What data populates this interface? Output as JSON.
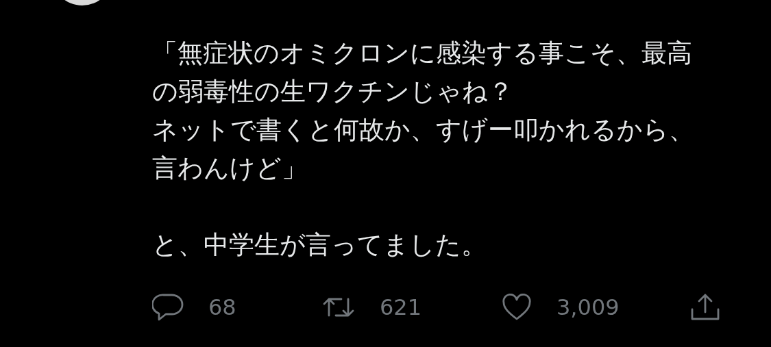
{
  "tweet": {
    "paragraphs": [
      {
        "lines": [
          "「無症状のオミクロンに感染する事こそ、最高の弱毒性の生ワクチンじゃね？",
          "ネットで書くと何故か、すげー叩かれるから、",
          "言わんけど」"
        ]
      },
      {
        "lines": [
          "と、中学生が言ってました。"
        ]
      }
    ]
  },
  "actions": [
    {
      "kind": "reply",
      "count": "68"
    },
    {
      "kind": "retweet",
      "count": "621"
    },
    {
      "kind": "like",
      "count": "3,009"
    },
    {
      "kind": "share"
    }
  ]
}
